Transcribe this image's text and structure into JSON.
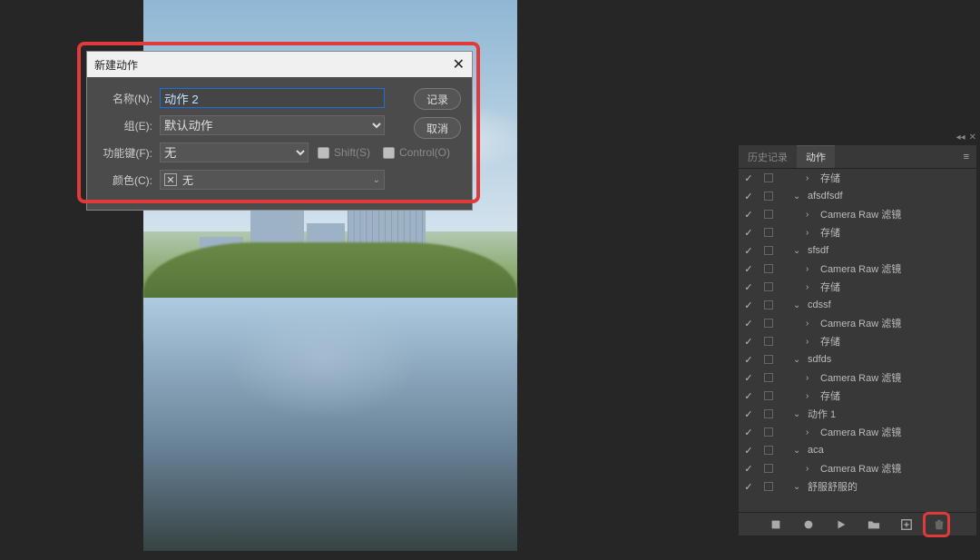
{
  "dialog": {
    "title": "新建动作",
    "name_label": "名称(N):",
    "name_value": "动作 2",
    "group_label": "组(E):",
    "group_value": "默认动作",
    "fnkey_label": "功能键(F):",
    "fnkey_value": "无",
    "shift_label": "Shift(S)",
    "control_label": "Control(O)",
    "color_label": "颜色(C):",
    "color_value": "无",
    "record_label": "记录",
    "cancel_label": "取消"
  },
  "panel": {
    "tab_history": "历史记录",
    "tab_actions": "动作",
    "items": [
      {
        "indent": 2,
        "arrow": ">",
        "label": "存储"
      },
      {
        "indent": 1,
        "arrow": "v",
        "label": "afsdfsdf"
      },
      {
        "indent": 2,
        "arrow": ">",
        "label": "Camera Raw 滤镜"
      },
      {
        "indent": 2,
        "arrow": ">",
        "label": "存储"
      },
      {
        "indent": 1,
        "arrow": "v",
        "label": "sfsdf"
      },
      {
        "indent": 2,
        "arrow": ">",
        "label": "Camera Raw 滤镜"
      },
      {
        "indent": 2,
        "arrow": ">",
        "label": "存储"
      },
      {
        "indent": 1,
        "arrow": "v",
        "label": "cdssf"
      },
      {
        "indent": 2,
        "arrow": ">",
        "label": "Camera Raw 滤镜"
      },
      {
        "indent": 2,
        "arrow": ">",
        "label": "存储"
      },
      {
        "indent": 1,
        "arrow": "v",
        "label": "sdfds"
      },
      {
        "indent": 2,
        "arrow": ">",
        "label": "Camera Raw 滤镜"
      },
      {
        "indent": 2,
        "arrow": ">",
        "label": "存储"
      },
      {
        "indent": 1,
        "arrow": "v",
        "label": "动作 1"
      },
      {
        "indent": 2,
        "arrow": ">",
        "label": "Camera Raw 滤镜"
      },
      {
        "indent": 1,
        "arrow": "v",
        "label": "aca"
      },
      {
        "indent": 2,
        "arrow": ">",
        "label": "Camera Raw 滤镜"
      },
      {
        "indent": 1,
        "arrow": "v",
        "label": "舒服舒服的"
      }
    ]
  }
}
